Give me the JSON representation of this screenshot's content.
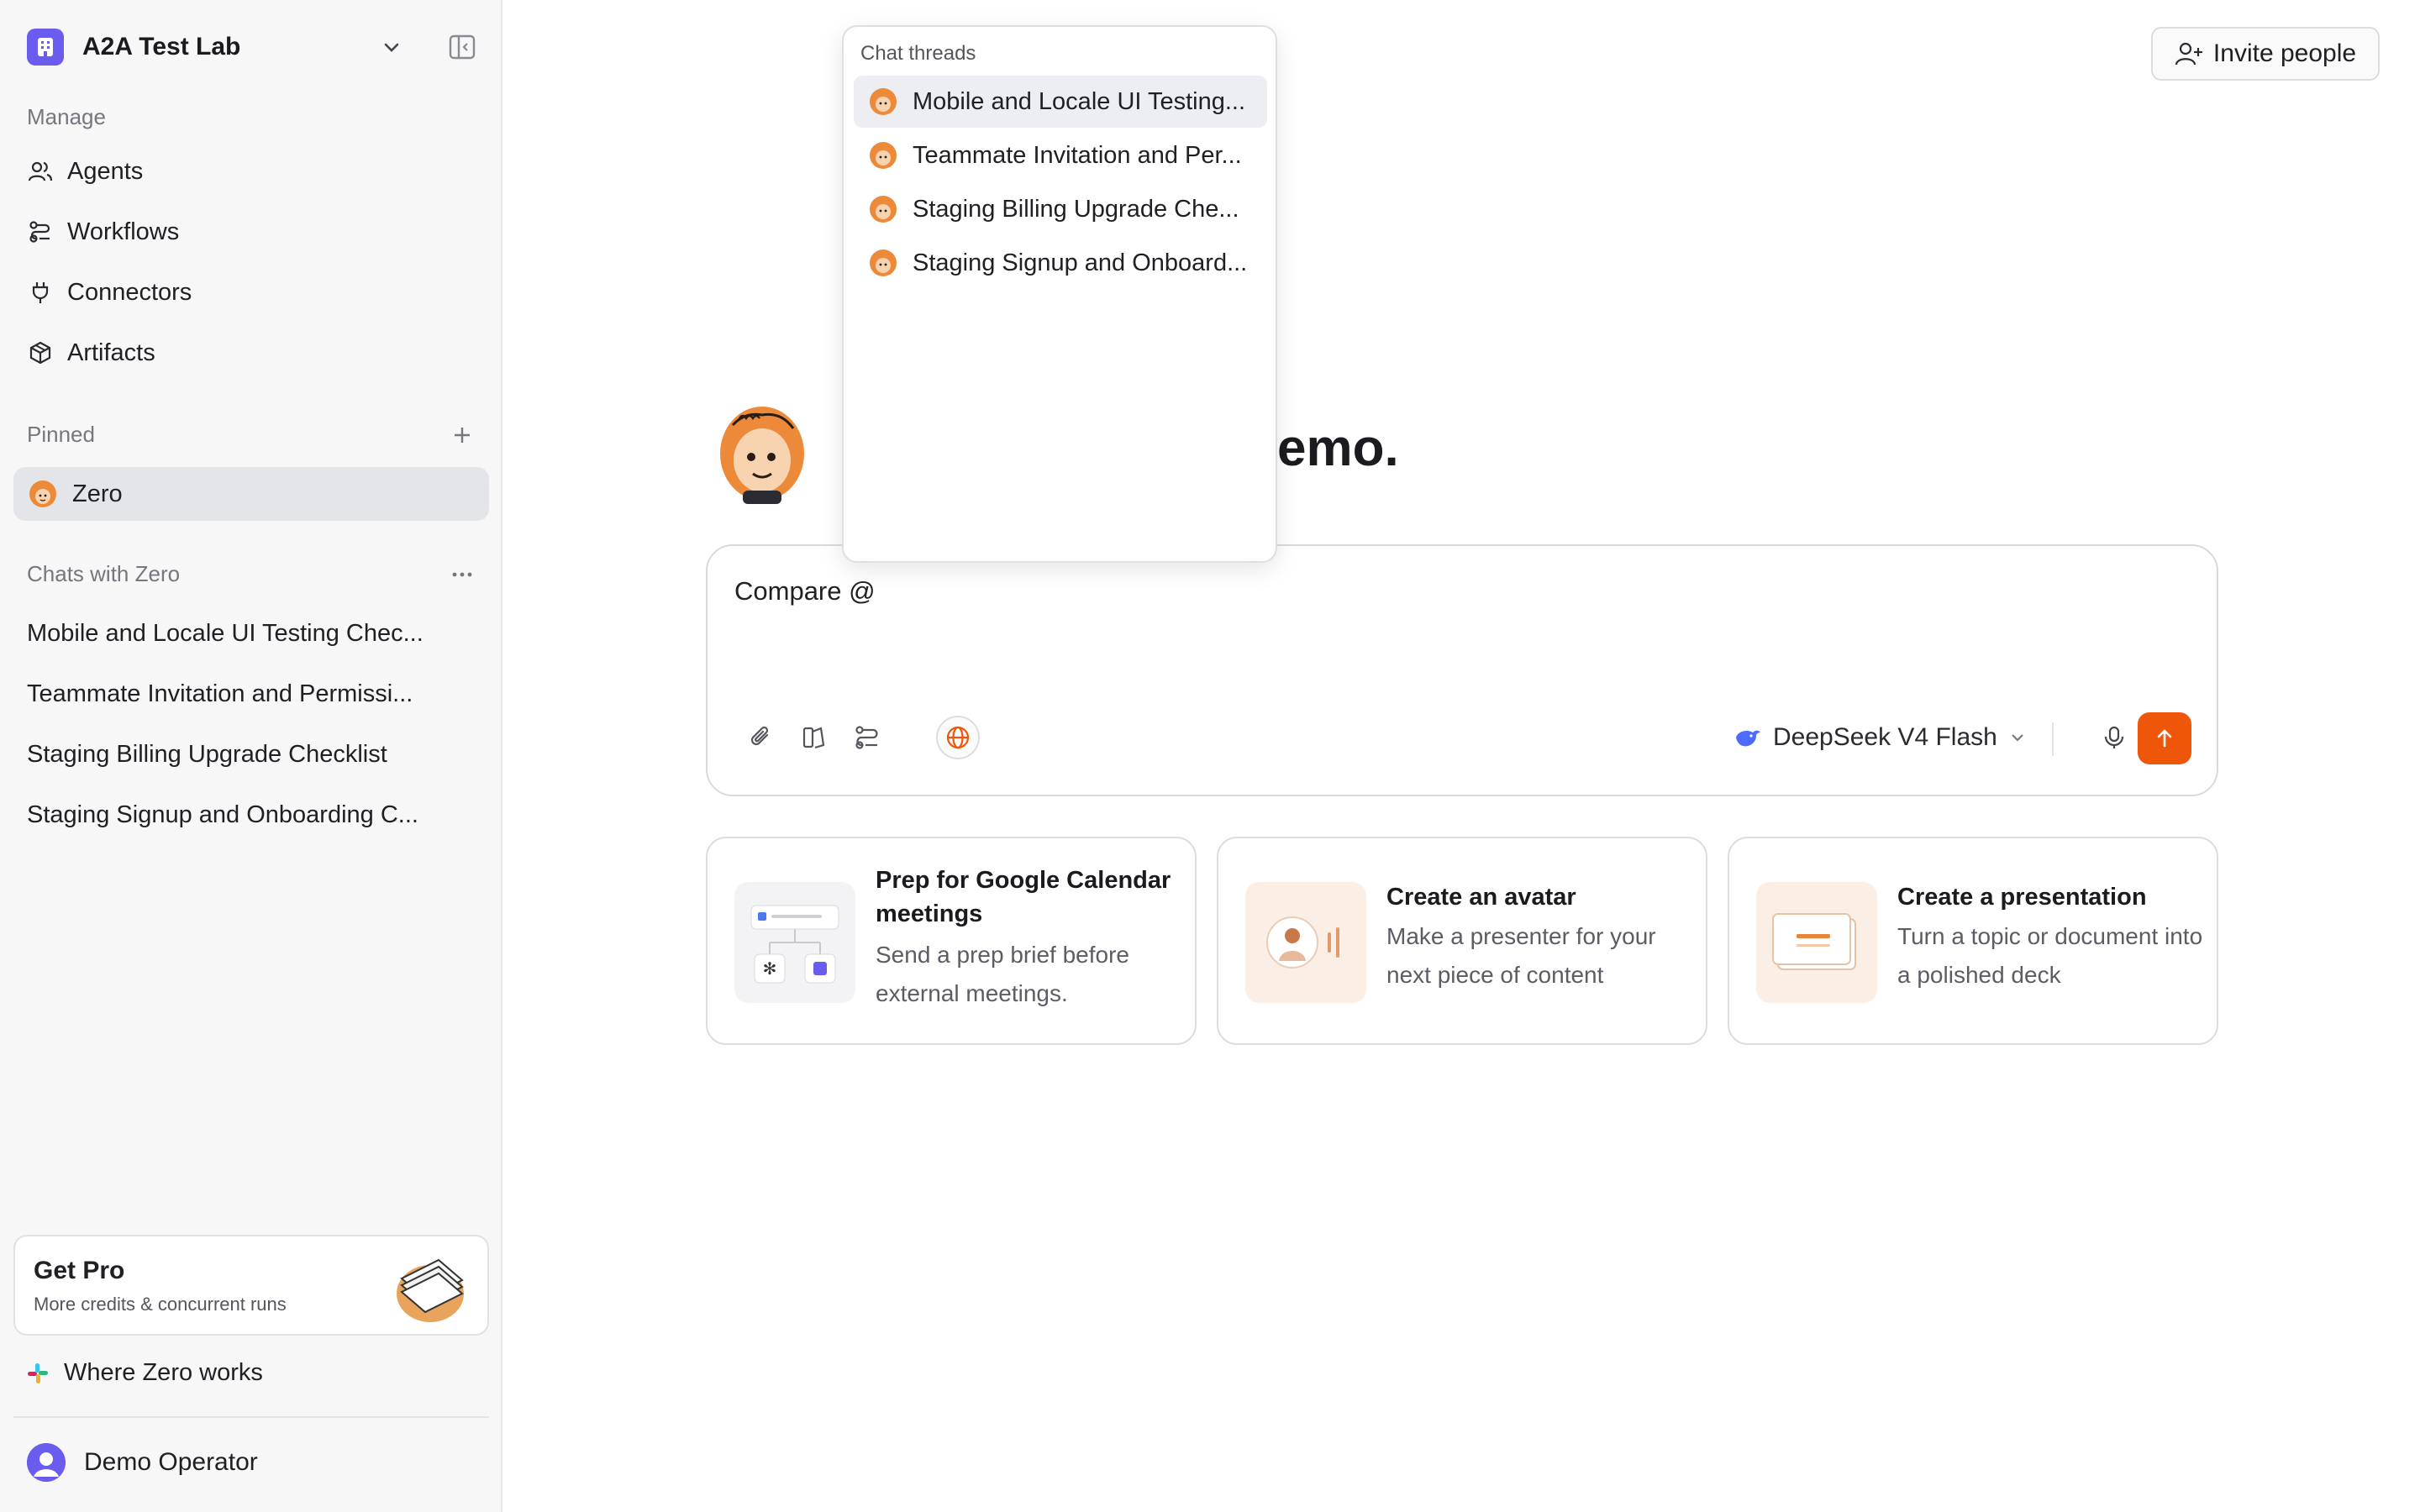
{
  "workspace": {
    "name": "A2A Test Lab"
  },
  "sidebar": {
    "manage_label": "Manage",
    "nav": [
      {
        "label": "Agents",
        "icon": "users-icon"
      },
      {
        "label": "Workflows",
        "icon": "workflow-icon"
      },
      {
        "label": "Connectors",
        "icon": "plug-icon"
      },
      {
        "label": "Artifacts",
        "icon": "box-icon"
      }
    ],
    "pinned_label": "Pinned",
    "pinned": [
      {
        "label": "Zero"
      }
    ],
    "chats_label": "Chats with Zero",
    "chats": [
      "Mobile and Locale UI Testing Chec...",
      "Teammate Invitation and Permissi...",
      "Staging Billing Upgrade Checklist",
      "Staging Signup and Onboarding C..."
    ],
    "get_pro": {
      "title": "Get Pro",
      "subtitle": "More credits & concurrent runs"
    },
    "where_zero_works": "Where Zero works",
    "user": {
      "name": "Demo Operator"
    }
  },
  "header": {
    "invite_label": "Invite people"
  },
  "hero": {
    "title_visible": "emo."
  },
  "composer": {
    "text": "Compare @",
    "model": "DeepSeek V4 Flash",
    "accent": "#f0560a"
  },
  "cards": [
    {
      "title": "Prep for Google Calendar meetings",
      "desc": "Send a prep brief before external meetings."
    },
    {
      "title": "Create an avatar",
      "desc": "Make a presenter for your next piece of content"
    },
    {
      "title": "Create a presentation",
      "desc": "Turn a topic or document into a polished deck"
    }
  ],
  "dropdown": {
    "label": "Chat threads",
    "items": [
      "Mobile and Locale UI Testing...",
      "Teammate Invitation and Per...",
      "Staging Billing Upgrade Che...",
      "Staging Signup and Onboard..."
    ]
  }
}
